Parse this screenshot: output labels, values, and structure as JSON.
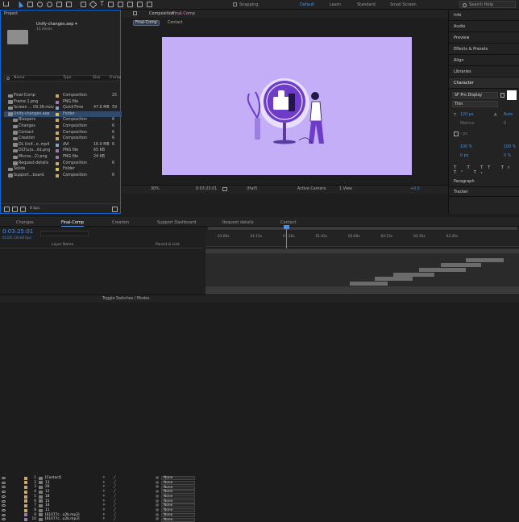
{
  "menu": {
    "snapping": "Snapping",
    "workspaces": [
      "Default",
      "Learn",
      "Standard",
      "Small Screen"
    ],
    "search": "Search Help"
  },
  "project": {
    "title": "Project",
    "file_name": "Unify-changes.aep ▾",
    "file_items": "11 items",
    "columns": {
      "name": "Name",
      "type": "Type",
      "size": "Size",
      "frame": "Frame"
    },
    "rows": [
      {
        "name": "Final-Comp",
        "type": "Composition",
        "size": "",
        "frame": "25",
        "color": "#c7a96a"
      },
      {
        "name": "Frame 1.png",
        "type": "PNG file",
        "size": "",
        "frame": "",
        "color": "#9c7aa8"
      },
      {
        "name": "Screen ... 09.38.mov",
        "type": "QuickTime",
        "size": "47.6 MB",
        "frame": "59",
        "color": "#7fa3c9"
      },
      {
        "name": "Unify-changes.aep",
        "type": "Folder",
        "size": "",
        "frame": "",
        "color": "#d4c24a"
      },
      {
        "name": "Bloopers",
        "type": "Composition",
        "size": "",
        "frame": "6",
        "color": "#c7a96a"
      },
      {
        "name": "Changes",
        "type": "Composition",
        "size": "",
        "frame": "6",
        "color": "#c7a96a"
      },
      {
        "name": "Contact",
        "type": "Composition",
        "size": "",
        "frame": "6",
        "color": "#c7a96a"
      },
      {
        "name": "Creation",
        "type": "Composition",
        "size": "",
        "frame": "6",
        "color": "#c7a96a"
      },
      {
        "name": "DL Unif...o..mp4",
        "type": "AVI",
        "size": "16.0 MB",
        "frame": "6",
        "color": "#7fa3c9"
      },
      {
        "name": "DLT(u)o...ild.png",
        "type": "PNG file",
        "size": "65 KB",
        "frame": "",
        "color": "#9c7aa8"
      },
      {
        "name": "Micros...2).png",
        "type": "PNG file",
        "size": "24 KB",
        "frame": "",
        "color": "#9c7aa8"
      },
      {
        "name": "Request-details",
        "type": "Composition",
        "size": "",
        "frame": "6",
        "color": "#c7a96a"
      },
      {
        "name": "Solids",
        "type": "Folder",
        "size": "",
        "frame": "",
        "color": "#d4c24a"
      },
      {
        "name": "Support...board",
        "type": "Composition",
        "size": "",
        "frame": "6",
        "color": "#c7a96a"
      }
    ],
    "bpc": "8 bpc"
  },
  "composition": {
    "title": "Composition",
    "comp_name": "Final-Comp",
    "tabs": [
      "Final-Comp",
      "Contact"
    ],
    "zoom": "30%",
    "timecode": "0:03:25:01",
    "resolution": "(Half)",
    "camera": "Active Camera",
    "view": "1 View",
    "exposure": "+0.0",
    "bg_color": "#c3aef7",
    "accent": "#6f3cc9"
  },
  "right_panel": {
    "items": [
      "Info",
      "Audio",
      "Preview",
      "Effects & Presets",
      "Align",
      "Libraries",
      "Character"
    ],
    "character": {
      "font": "SF Pro Display",
      "style": "Thin",
      "size": "120 px",
      "leading": "Auto",
      "tracking_label": "Metrics",
      "tracking": "0",
      "stroke": "- px",
      "vscale": "100 %",
      "hscale": "100 %",
      "baseline": "0 px",
      "tsume": "0 %"
    },
    "paragraph": "Paragraph",
    "tracker": "Tracker"
  },
  "timeline": {
    "tabs": [
      "Changes",
      "Final-Comp",
      "Creation",
      "Support Dashboard",
      "Request details",
      "Contact"
    ],
    "active_tab": "Final-Comp",
    "timecode": "0:03:25:01",
    "subtime": "01325 (30.00 fps)",
    "header": {
      "layer_name": "Layer Name",
      "parent": "Parent & Link"
    },
    "ruler": [
      "01:00s",
      "01:15s",
      "01:30s",
      "01:45s",
      "02:00s",
      "02:15s",
      "02:30s",
      "02:45s"
    ],
    "footer": "Toggle Switches / Modes",
    "layers": [
      {
        "num": "1",
        "name": "[Contact]",
        "label": "#c7a96a",
        "parent": "None",
        "bar_start": 0.0,
        "bar_end": 1.0,
        "dark": true
      },
      {
        "num": "2",
        "name": "13",
        "label": "#c7a96a",
        "parent": "None",
        "bar_start": 0.0,
        "bar_end": 0.0
      },
      {
        "num": "3",
        "name": "20",
        "label": "#c7a96a",
        "parent": "None",
        "bar_start": 0.83,
        "bar_end": 0.95
      },
      {
        "num": "4",
        "name": "12",
        "label": "#c7a96a",
        "parent": "None",
        "bar_start": 0.75,
        "bar_end": 0.88
      },
      {
        "num": "5",
        "name": "18",
        "label": "#c7a96a",
        "parent": "None",
        "bar_start": 0.68,
        "bar_end": 0.83
      },
      {
        "num": "6",
        "name": "15",
        "label": "#c7a96a",
        "parent": "None",
        "bar_start": 0.6,
        "bar_end": 0.73
      },
      {
        "num": "7",
        "name": "14",
        "label": "#c7a96a",
        "parent": "None",
        "bar_start": 0.54,
        "bar_end": 0.66
      },
      {
        "num": "8",
        "name": "11",
        "label": "#c7a96a",
        "parent": "None",
        "bar_start": 0.46,
        "bar_end": 0.58
      },
      {
        "num": "9",
        "name": "[61077c...a2b.mp3]",
        "label": "#9c7aa8",
        "parent": "None",
        "bar_start": 0.0,
        "bar_end": 1.0,
        "dark": true
      },
      {
        "num": "10",
        "name": "[61077c...a2b.mp3]",
        "label": "#9c7aa8",
        "parent": "None",
        "bar_start": 0.0,
        "bar_end": 1.0,
        "dark": true
      }
    ]
  }
}
